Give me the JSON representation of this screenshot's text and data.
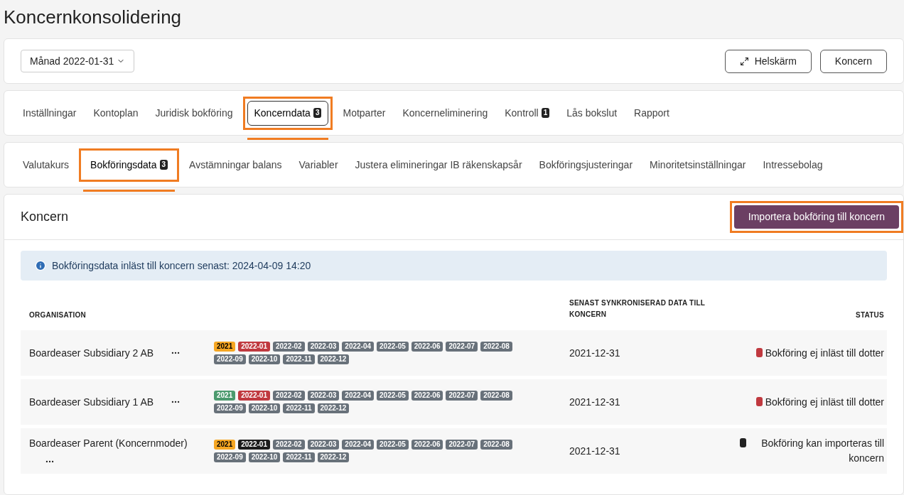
{
  "title": "Koncernkonsolidering",
  "toolbar": {
    "period": "Månad 2022-01-31",
    "buttons": [
      {
        "kind": "fullscreen",
        "label": "Helskärm"
      },
      {
        "kind": "plain",
        "label": "Koncern"
      }
    ]
  },
  "tabs": [
    {
      "label": "Inställningar",
      "selected": false,
      "highlighted": false
    },
    {
      "label": "Kontoplan",
      "selected": false,
      "highlighted": false
    },
    {
      "label": "Juridisk bokföring",
      "selected": false,
      "highlighted": false
    },
    {
      "label": "Koncerndata",
      "badge": "3",
      "selected": true,
      "highlighted": true
    },
    {
      "label": "Motparter",
      "selected": false,
      "highlighted": false
    },
    {
      "label": "Koncerneliminering",
      "selected": false,
      "highlighted": false
    },
    {
      "label": "Kontroll",
      "badge": "1",
      "selected": false,
      "highlighted": false
    },
    {
      "label": "Lås bokslut",
      "selected": false,
      "highlighted": false
    },
    {
      "label": "Rapport",
      "selected": false,
      "highlighted": false
    }
  ],
  "subtabs": [
    {
      "label": "Valutakurs",
      "selected": false,
      "highlighted": false
    },
    {
      "label": "Bokföringsdata",
      "badge": "3",
      "selected": true,
      "highlighted": true
    },
    {
      "label": "Avstämningar balans",
      "selected": false,
      "highlighted": false
    },
    {
      "label": "Variabler",
      "selected": false,
      "highlighted": false
    },
    {
      "label": "Justera elimineringar IB räkenskapsår",
      "selected": false,
      "highlighted": false
    },
    {
      "label": "Bokföringsjusteringar",
      "selected": false,
      "highlighted": false
    },
    {
      "label": "Minoritetsinställningar",
      "selected": false,
      "highlighted": false
    },
    {
      "label": "Intressebolag",
      "selected": false,
      "highlighted": false
    }
  ],
  "panel": {
    "title": "Koncern",
    "import_button": {
      "label": "Importera bokföring till koncern",
      "highlighted": true
    },
    "info": "Bokföringsdata inläst till koncern senast: 2024-04-09 14:20",
    "table": {
      "columns": [
        "ORGANISATION",
        "SENAST SYNKRONISERAD DATA TILL KONCERN",
        "STATUS"
      ],
      "rows": [
        {
          "organisation": "Boardeaser Subsidiary 2 AB",
          "synced": "2021-12-31",
          "status": {
            "label": "Bokföring ej inläst till dotter",
            "color": "#c0393f"
          },
          "periods": [
            {
              "label": "2021",
              "color": "#f5a623"
            },
            {
              "label": "2022-01",
              "color": "#c0393f"
            },
            {
              "label": "2022-02",
              "color": "#68717a"
            },
            {
              "label": "2022-03",
              "color": "#68717a"
            },
            {
              "label": "2022-04",
              "color": "#68717a"
            },
            {
              "label": "2022-05",
              "color": "#68717a"
            },
            {
              "label": "2022-06",
              "color": "#68717a"
            },
            {
              "label": "2022-07",
              "color": "#68717a"
            },
            {
              "label": "2022-08",
              "color": "#68717a"
            },
            {
              "label": "2022-09",
              "color": "#68717a"
            },
            {
              "label": "2022-10",
              "color": "#68717a"
            },
            {
              "label": "2022-11",
              "color": "#68717a"
            },
            {
              "label": "2022-12",
              "color": "#68717a"
            }
          ]
        },
        {
          "organisation": "Boardeaser Subsidiary 1 AB",
          "synced": "2021-12-31",
          "status": {
            "label": "Bokföring ej inläst till dotter",
            "color": "#c0393f"
          },
          "periods": [
            {
              "label": "2021",
              "color": "#4c9a6e"
            },
            {
              "label": "2022-01",
              "color": "#c0393f"
            },
            {
              "label": "2022-02",
              "color": "#68717a"
            },
            {
              "label": "2022-03",
              "color": "#68717a"
            },
            {
              "label": "2022-04",
              "color": "#68717a"
            },
            {
              "label": "2022-05",
              "color": "#68717a"
            },
            {
              "label": "2022-06",
              "color": "#68717a"
            },
            {
              "label": "2022-07",
              "color": "#68717a"
            },
            {
              "label": "2022-08",
              "color": "#68717a"
            },
            {
              "label": "2022-09",
              "color": "#68717a"
            },
            {
              "label": "2022-10",
              "color": "#68717a"
            },
            {
              "label": "2022-11",
              "color": "#68717a"
            },
            {
              "label": "2022-12",
              "color": "#68717a"
            }
          ]
        },
        {
          "organisation": "Boardeaser Parent (Koncernmoder)",
          "synced": "2021-12-31",
          "status": {
            "label": "Bokföring kan importeras till koncern",
            "color": "#222222"
          },
          "periods": [
            {
              "label": "2021",
              "color": "#f5a623"
            },
            {
              "label": "2022-01",
              "color": "#1c1c1c"
            },
            {
              "label": "2022-02",
              "color": "#68717a"
            },
            {
              "label": "2022-03",
              "color": "#68717a"
            },
            {
              "label": "2022-04",
              "color": "#68717a"
            },
            {
              "label": "2022-05",
              "color": "#68717a"
            },
            {
              "label": "2022-06",
              "color": "#68717a"
            },
            {
              "label": "2022-07",
              "color": "#68717a"
            },
            {
              "label": "2022-08",
              "color": "#68717a"
            },
            {
              "label": "2022-09",
              "color": "#68717a"
            },
            {
              "label": "2022-10",
              "color": "#68717a"
            },
            {
              "label": "2022-11",
              "color": "#68717a"
            },
            {
              "label": "2022-12",
              "color": "#68717a"
            }
          ]
        }
      ]
    }
  }
}
